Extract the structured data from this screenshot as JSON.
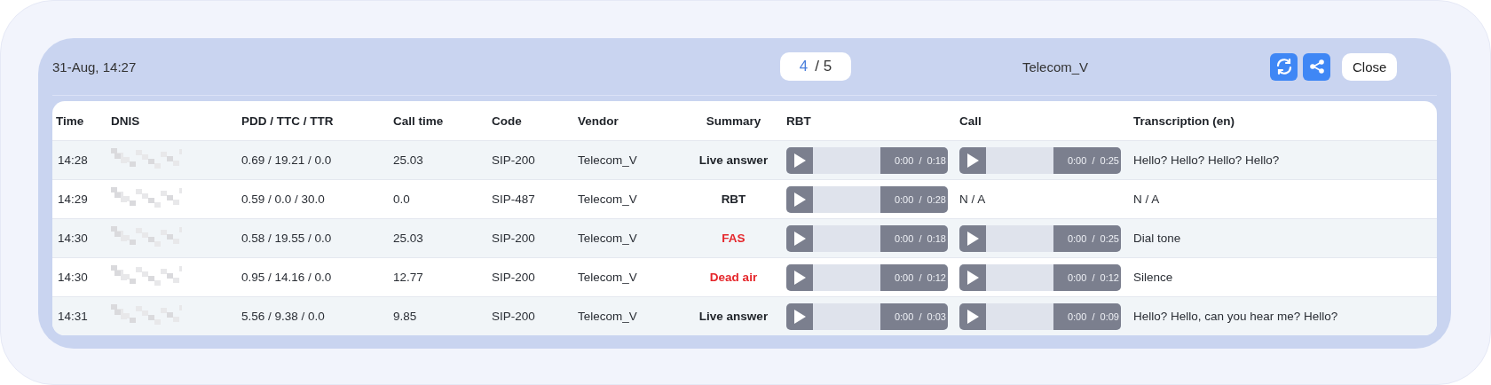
{
  "header": {
    "date": "31-Aug, 14:27",
    "pager": {
      "current": "4",
      "total": "/ 5"
    },
    "vendor": "Telecom_V",
    "buttons": [
      {
        "kind": "refresh"
      },
      {
        "kind": "share"
      },
      {
        "kind": "text",
        "label": "Close"
      }
    ]
  },
  "table": {
    "columns": [
      "Time",
      "DNIS",
      "PDD / TTC / TTR",
      "Call time",
      "Code",
      "Vendor",
      "Summary",
      "RBT",
      "Call",
      "Transcription (en)"
    ],
    "rows": [
      {
        "time": "14:28",
        "pdd": "0.69 / 19.21 / 0.0",
        "call_time": "25.03",
        "code": "SIP-200",
        "vendor": "Telecom_V",
        "summary": "Live answer",
        "color": "#1f2329",
        "rbt": {
          "kind": "player",
          "time": "0:00  /  0:18"
        },
        "call": {
          "kind": "player",
          "time": "0:00  /  0:25"
        },
        "transcription": "Hello? Hello? Hello? Hello?"
      },
      {
        "time": "14:29",
        "pdd": "0.59 / 0.0 / 30.0",
        "call_time": "0.0",
        "code": "SIP-487",
        "vendor": "Telecom_V",
        "summary": "RBT",
        "color": "#1f2329",
        "rbt": {
          "kind": "player",
          "time": "0:00  /  0:28"
        },
        "call": {
          "kind": "text",
          "text": "N / A"
        },
        "transcription": "N / A"
      },
      {
        "time": "14:30",
        "pdd": "0.58 / 19.55 / 0.0",
        "call_time": "25.03",
        "code": "SIP-200",
        "vendor": "Telecom_V",
        "summary": "FAS",
        "color": "#e5262b",
        "rbt": {
          "kind": "player",
          "time": "0:00  /  0:18"
        },
        "call": {
          "kind": "player",
          "time": "0:00  /  0:25"
        },
        "transcription": "Dial tone"
      },
      {
        "time": "14:30",
        "pdd": "0.95 / 14.16 / 0.0",
        "call_time": "12.77",
        "code": "SIP-200",
        "vendor": "Telecom_V",
        "summary": "Dead air",
        "color": "#e5262b",
        "rbt": {
          "kind": "player",
          "time": "0:00  /  0:12"
        },
        "call": {
          "kind": "player",
          "time": "0:00  /  0:12"
        },
        "transcription": "Silence"
      },
      {
        "time": "14:31",
        "pdd": "5.56 / 9.38 / 0.0",
        "call_time": "9.85",
        "code": "SIP-200",
        "vendor": "Telecom_V",
        "summary": "Live answer",
        "color": "#1f2329",
        "rbt": {
          "kind": "player",
          "time": "0:00  /  0:03"
        },
        "call": {
          "kind": "player",
          "time": "0:00  /  0:09"
        },
        "transcription": "Hello? Hello, can you hear me? Hello?"
      }
    ]
  }
}
